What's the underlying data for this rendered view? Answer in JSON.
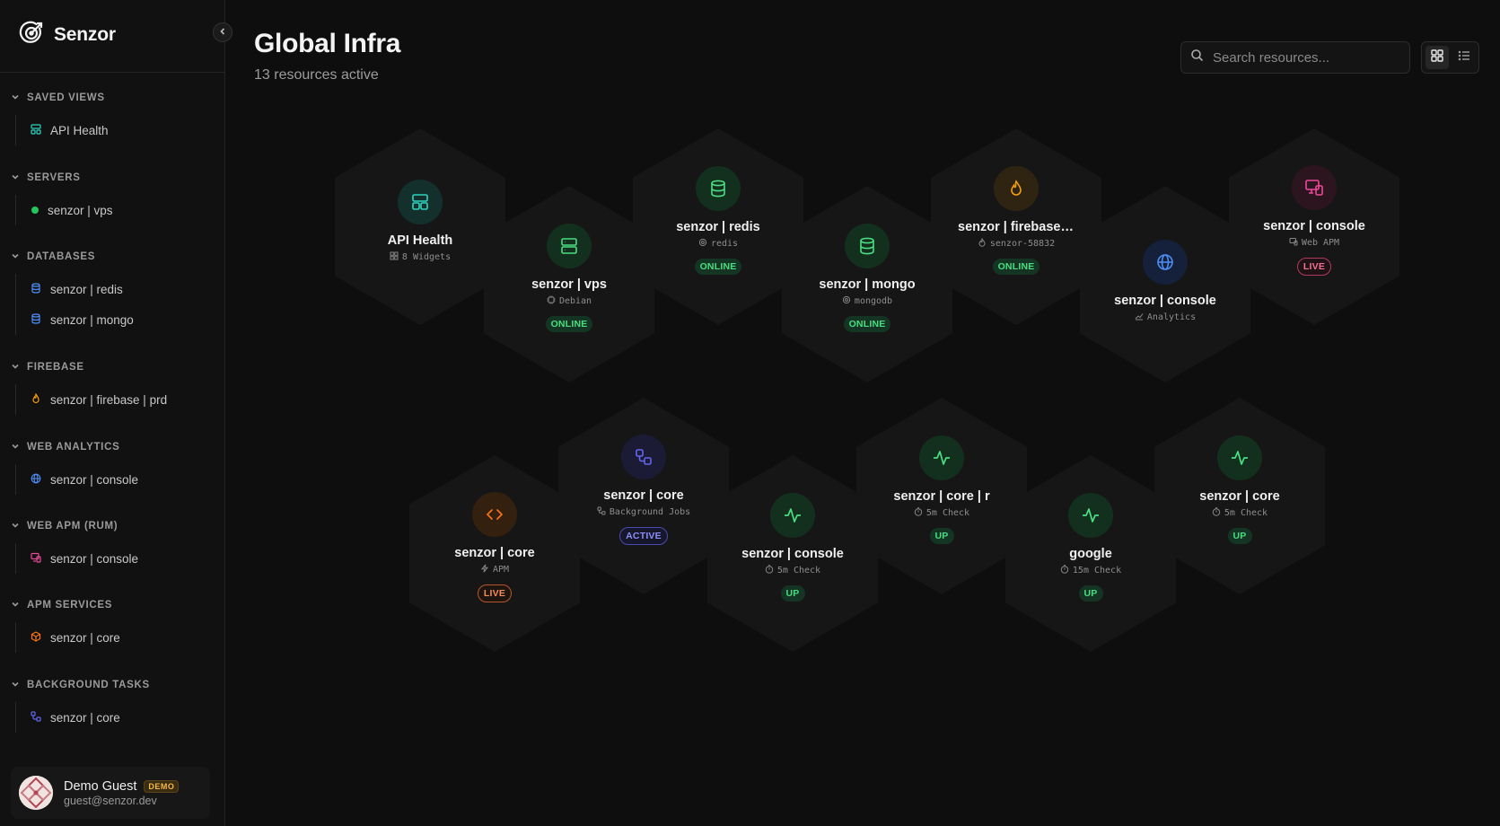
{
  "app": {
    "name": "Senzor"
  },
  "sidebar": {
    "sections": [
      {
        "title": "SAVED VIEWS",
        "items": [
          {
            "label": "API Health",
            "icon": "dashboard-icon"
          }
        ]
      },
      {
        "title": "SERVERS",
        "items": [
          {
            "label": "senzor | vps",
            "icon": "status-dot"
          }
        ]
      },
      {
        "title": "DATABASES",
        "items": [
          {
            "label": "senzor | redis",
            "icon": "database-icon"
          },
          {
            "label": "senzor | mongo",
            "icon": "database-icon"
          }
        ]
      },
      {
        "title": "FIREBASE",
        "items": [
          {
            "label": "senzor | firebase | prd",
            "icon": "flame-icon"
          }
        ]
      },
      {
        "title": "WEB ANALYTICS",
        "items": [
          {
            "label": "senzor | console",
            "icon": "globe-icon"
          }
        ]
      },
      {
        "title": "WEB APM (RUM)",
        "items": [
          {
            "label": "senzor | console",
            "icon": "monitor-icon"
          }
        ]
      },
      {
        "title": "APM SERVICES",
        "items": [
          {
            "label": "senzor | core",
            "icon": "box-icon"
          }
        ]
      },
      {
        "title": "BACKGROUND TASKS",
        "items": [
          {
            "label": "senzor | core",
            "icon": "workflow-icon"
          }
        ]
      }
    ]
  },
  "user": {
    "name": "Demo Guest",
    "badge": "DEMO",
    "email": "guest@senzor.dev"
  },
  "header": {
    "title": "Global Infra",
    "subtitle": "13 resources active"
  },
  "search": {
    "placeholder": "Search resources..."
  },
  "tiles": [
    {
      "title": "API Health",
      "sub": "8 Widgets",
      "icon": "dashboard-icon",
      "status": ""
    },
    {
      "title": "senzor | vps",
      "sub": "Debian",
      "icon": "server-icon",
      "status": "ONLINE"
    },
    {
      "title": "senzor | redis",
      "sub": "redis",
      "icon": "database-icon",
      "status": "ONLINE"
    },
    {
      "title": "senzor | mongo",
      "sub": "mongodb",
      "icon": "database-icon",
      "status": "ONLINE"
    },
    {
      "title": "senzor | firebase | prd",
      "sub": "senzor-58832",
      "icon": "flame-icon",
      "status": "ONLINE"
    },
    {
      "title": "senzor | console",
      "sub": "Analytics",
      "icon": "globe-icon",
      "status": ""
    },
    {
      "title": "senzor | console",
      "sub": "Web APM",
      "icon": "monitor-icon",
      "status": "LIVE"
    },
    {
      "title": "senzor | core",
      "sub": "APM",
      "icon": "code-icon",
      "status": "LIVE"
    },
    {
      "title": "senzor | core",
      "sub": "Background Jobs",
      "icon": "workflow-icon",
      "status": "ACTIVE"
    },
    {
      "title": "senzor | console",
      "sub": "5m Check",
      "icon": "pulse-icon",
      "status": "UP"
    },
    {
      "title": "senzor | core | r",
      "sub": "5m Check",
      "icon": "pulse-icon",
      "status": "UP"
    },
    {
      "title": "google",
      "sub": "15m Check",
      "icon": "pulse-icon",
      "status": "UP"
    },
    {
      "title": "senzor | core",
      "sub": "5m Check",
      "icon": "pulse-icon",
      "status": "UP"
    }
  ],
  "colors": {
    "teal": "#2dd4bf",
    "green": "#4ade80",
    "orange": "#f59e0b",
    "blue": "#4f8ef7",
    "pink": "#ec4899",
    "apm-orange": "#f97316",
    "indigo": "#6366f1"
  }
}
